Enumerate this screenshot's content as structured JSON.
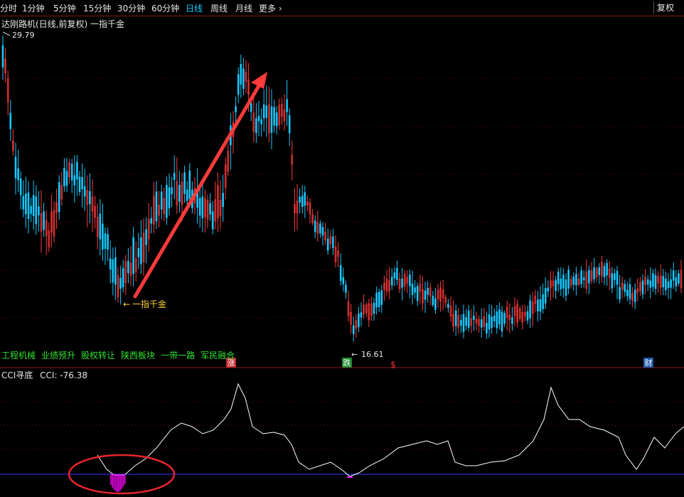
{
  "periods": [
    "分时",
    "1分钟",
    "5分钟",
    "15分钟",
    "30分钟",
    "60分钟",
    "日线",
    "周线",
    "月线"
  ],
  "active_period": "日线",
  "more_label": "更多",
  "more_icon": "chevron-right-icon",
  "adjust_label": "复权",
  "title": "达刚路机(日线,前复权) 一指千金",
  "high_label": "29.79",
  "low_label": "16.61",
  "annotation_label": "一指千金",
  "sector_tags": [
    "工程机械",
    "业绩预升",
    "股权转让",
    "陕西板块",
    "一带一路",
    "军民融合"
  ],
  "event_markers": [
    {
      "text": "涨",
      "color": "#c0282d"
    },
    {
      "text": "跌",
      "color": "#1e8a2e"
    },
    {
      "text": "$",
      "color": "#ff3030"
    },
    {
      "text": "财",
      "color": "#1f5aa8"
    }
  ],
  "cci_title": "CCI寻底",
  "cci_value_label": "CCI: -76.38",
  "colors": {
    "up": "#ff3b3b",
    "down": "#18c8ff",
    "grid": "#6b0f0f",
    "annotation": "#ffd23c",
    "arrow": "#ff3b3b",
    "cci_line": "#ffffff",
    "cci_signal": "#ff00ff",
    "baseline": "#2f3bff"
  }
}
